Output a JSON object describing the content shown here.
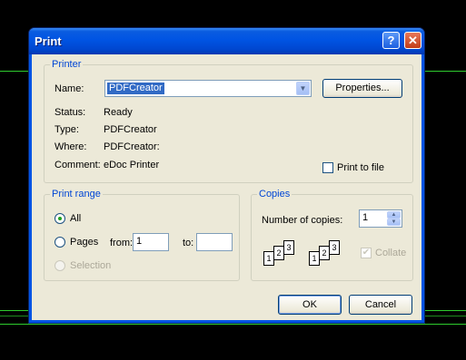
{
  "window": {
    "title": "Print"
  },
  "title_buttons": {
    "help": "?",
    "close": "✕"
  },
  "printer": {
    "legend": "Printer",
    "name_label": "Name:",
    "name_value": "PDFCreator",
    "properties_button": "Properties...",
    "status_label": "Status:",
    "status_value": "Ready",
    "type_label": "Type:",
    "type_value": "PDFCreator",
    "where_label": "Where:",
    "where_value": "PDFCreator:",
    "comment_label": "Comment:",
    "comment_value": "eDoc Printer",
    "print_to_file_label": "Print to file",
    "print_to_file_checked": false
  },
  "print_range": {
    "legend": "Print range",
    "all_label": "All",
    "pages_label": "Pages",
    "from_label": "from:",
    "from_value": "1",
    "to_label": "to:",
    "to_value": "",
    "selection_label": "Selection",
    "selected": "all"
  },
  "copies": {
    "legend": "Copies",
    "number_label": "Number of copies:",
    "number_value": "1",
    "collate_label": "Collate",
    "collate_checked": true,
    "page_numbers": [
      "1",
      "2",
      "3"
    ]
  },
  "buttons": {
    "ok": "OK",
    "cancel": "Cancel"
  },
  "colors": {
    "title_bar": "#0054e3",
    "dialog_bg": "#ece9d8",
    "group_legend": "#0046d5",
    "selection": "#316ac5",
    "background": "#000000",
    "guide_lines": "#2ecc2e"
  }
}
